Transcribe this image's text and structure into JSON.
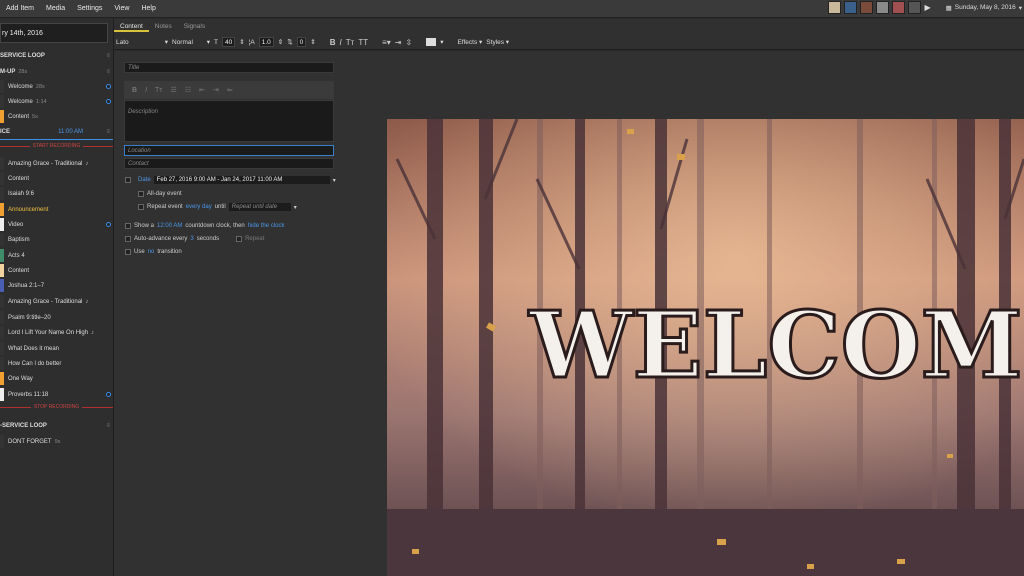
{
  "menu": {
    "items": [
      "Add Item",
      "Media",
      "Settings",
      "View",
      "Help"
    ]
  },
  "status": {
    "date": "Sunday, May 8, 2016"
  },
  "service": {
    "title": "ry 14th, 2016",
    "items": [
      {
        "label": "SERVICE LOOP",
        "type": "header"
      },
      {
        "label": "M-UP",
        "type": "header",
        "duration": "28s"
      },
      {
        "label": "Welcome",
        "duration": "28s",
        "color": "#333333",
        "dot": true
      },
      {
        "label": "Welcome",
        "duration": "1:14",
        "color": "#333333",
        "dot": true
      },
      {
        "label": "Content",
        "duration": "5s",
        "color": "#f0a030",
        "dot": false
      },
      {
        "label": "ICE",
        "type": "section",
        "time": "11:00 AM"
      },
      {
        "label": "START RECORDING",
        "type": "marker"
      },
      {
        "label": "Amazing Grace - Traditional",
        "color": "#333333",
        "music": true
      },
      {
        "label": "Content",
        "color": "#333333"
      },
      {
        "label": "Isaiah 9:6",
        "color": "#333333"
      },
      {
        "label": "Announcement",
        "color": "#f0a030",
        "highlight": true
      },
      {
        "label": "Video",
        "color": "#eeeeee",
        "dot": true
      },
      {
        "label": "Baptism",
        "color": "#333333"
      },
      {
        "label": "Acts 4",
        "color": "#3e8c6a"
      },
      {
        "label": "Content",
        "color": "#f2d2a0"
      },
      {
        "label": "Joshua 2:1–7",
        "color": "#4a5fb4"
      },
      {
        "label": "Amazing Grace - Traditional",
        "color": "#333333",
        "music": true
      },
      {
        "label": "Psalm 9:title–20",
        "color": "#333333"
      },
      {
        "label": "Lord I Lift Your Name On High",
        "color": "#333333",
        "music": true
      },
      {
        "label": "What Does it mean",
        "color": "#333333"
      },
      {
        "label": "How Can I do better",
        "color": "#333333"
      },
      {
        "label": "One Way",
        "color": "#f0a030"
      },
      {
        "label": "Proverbs 11:18",
        "color": "#eeeeee",
        "dot": true
      },
      {
        "label": "STOP RECORDING",
        "type": "marker"
      },
      {
        "label": "-SERVICE LOOP",
        "type": "header"
      },
      {
        "label": "DONT FORGET",
        "duration": "9s",
        "color": "#333333"
      }
    ]
  },
  "tabs": [
    "Content",
    "Notes",
    "Signals"
  ],
  "toolbar": {
    "font": "Lato",
    "weight": "Normal",
    "size_label": "T",
    "size": "40",
    "line_label": "¦A",
    "line": "1.0",
    "spacing_label": "⇅",
    "spacing": "0",
    "effects": "Effects",
    "styles": "Styles"
  },
  "form": {
    "title_placeholder": "Title",
    "description_placeholder": "Description",
    "location_placeholder": "Location",
    "contact_placeholder": "Contact",
    "date_label": "Date",
    "date_value": "Feb 27, 2016 9:00 AM - Jan 24, 2017 11:00 AM",
    "all_day": "All-day event",
    "repeat_event": "Repeat event",
    "repeat_freq": "every day",
    "until": "until",
    "repeat_until_placeholder": "Repeat until date",
    "countdown_pre": "Show a",
    "countdown_time": "12:00 AM",
    "countdown_mid": "countdown clock, then",
    "countdown_link": "hide the clock",
    "auto_advance_pre": "Auto-advance every",
    "auto_advance_num": "3",
    "auto_advance_post": "seconds",
    "repeat": "Repeat",
    "use": "Use",
    "transition_link": "no",
    "transition": "transition"
  },
  "preview": {
    "text": "WELCOME"
  }
}
